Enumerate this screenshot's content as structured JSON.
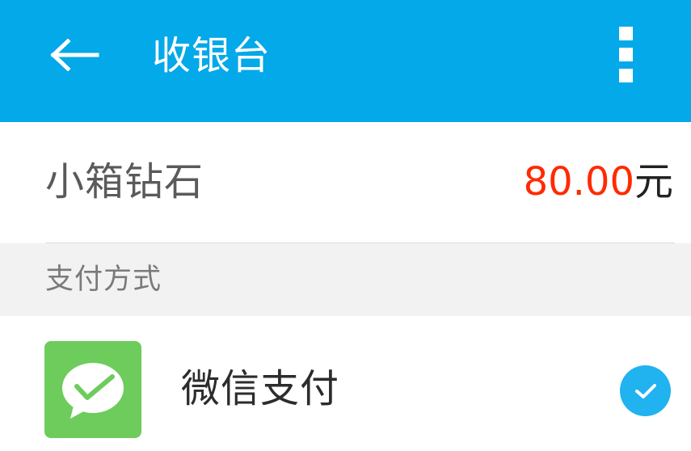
{
  "header": {
    "title": "收银台",
    "background_color": "#03a9e8",
    "back_icon": "arrow-left-icon",
    "menu_icon": "more-vertical-icon"
  },
  "product": {
    "name": "小箱钻石",
    "price_amount": "80.00",
    "price_unit": "元",
    "price_color": "#ff2a00"
  },
  "payment_section": {
    "label": "支付方式"
  },
  "payment_methods": [
    {
      "label": "微信支付",
      "icon": "wechat-pay-icon",
      "selected": true,
      "check_icon": "check-circle-icon",
      "check_color": "#21b2f0"
    }
  ]
}
